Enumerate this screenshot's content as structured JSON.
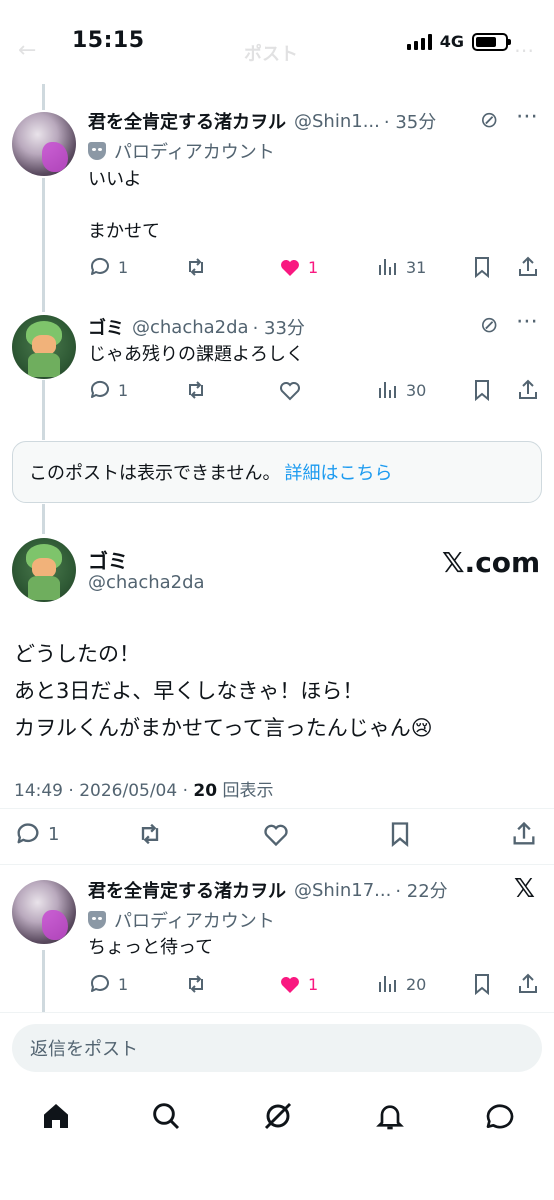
{
  "status_bar": {
    "time": "15:15",
    "network": "4G"
  },
  "header": {
    "title": "ポスト"
  },
  "reply1": {
    "name": "君を全肯定する渚カヲル",
    "handle": "@Shin1...",
    "time": "· 35分",
    "label": "パロディアカウント",
    "text_line1": "いいよ",
    "text_line2": "まかせて",
    "replies": "1",
    "likes": "1",
    "views": "31"
  },
  "reply2": {
    "name": "ゴミ",
    "handle": "@chacha2da",
    "time": "· 33分",
    "text": "じゃあ残りの課題よろしく",
    "replies": "1",
    "views": "30"
  },
  "unavailable": {
    "text": "このポストは表示できません。",
    "link": "詳細はこちら"
  },
  "focus": {
    "name": "ゴミ",
    "handle": "@chacha2da",
    "brand": "𝕏.com",
    "line1": "どうしたの！",
    "line2": "あと3日だよ、早くしなきゃ！ほら！",
    "line3": "カヲルくんがまかせてって言ったんじゃん😢",
    "meta": "14:49 · 2026/05/04 · ",
    "views_count": "20",
    "views_label": " 回表示",
    "replies": "1"
  },
  "reply3": {
    "name": "君を全肯定する渚カヲル",
    "handle": "@Shin17...",
    "time": "· 22分",
    "label": "パロディアカウント",
    "text": "ちょっと待って",
    "replies": "1",
    "likes": "1",
    "views": "20"
  },
  "compose": {
    "placeholder": "返信をポスト"
  },
  "tabs": [
    "home",
    "search",
    "grok",
    "notifications",
    "messages"
  ]
}
